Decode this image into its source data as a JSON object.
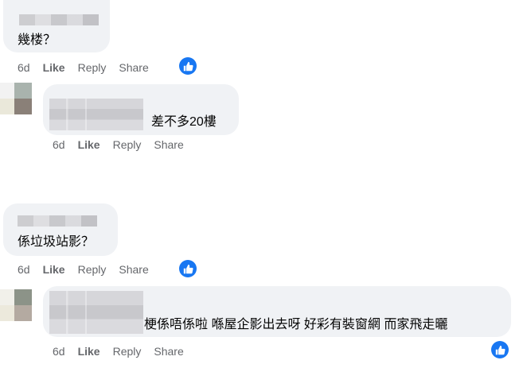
{
  "comments": [
    {
      "text": "幾楼？",
      "time": "6d",
      "like": "Like",
      "reply": "Reply",
      "share": "Share",
      "reaction": "like-icon"
    },
    {
      "text": "差不多20樓",
      "time": "6d",
      "like": "Like",
      "reply": "Reply",
      "share": "Share"
    },
    {
      "text": "係垃圾站影？",
      "time": "6d",
      "like": "Like",
      "reply": "Reply",
      "share": "Share",
      "reaction": "like-icon"
    },
    {
      "text": "梗係唔係啦 喺屋企影出去呀 好彩有裝窗網 而家飛走曬",
      "time": "6d",
      "like": "Like",
      "reply": "Reply",
      "share": "Share",
      "reaction": "like-icon"
    }
  ],
  "colors": {
    "bubble": "#f0f2f5",
    "action_text": "#65676b",
    "reaction_blue": "#1877f2"
  }
}
